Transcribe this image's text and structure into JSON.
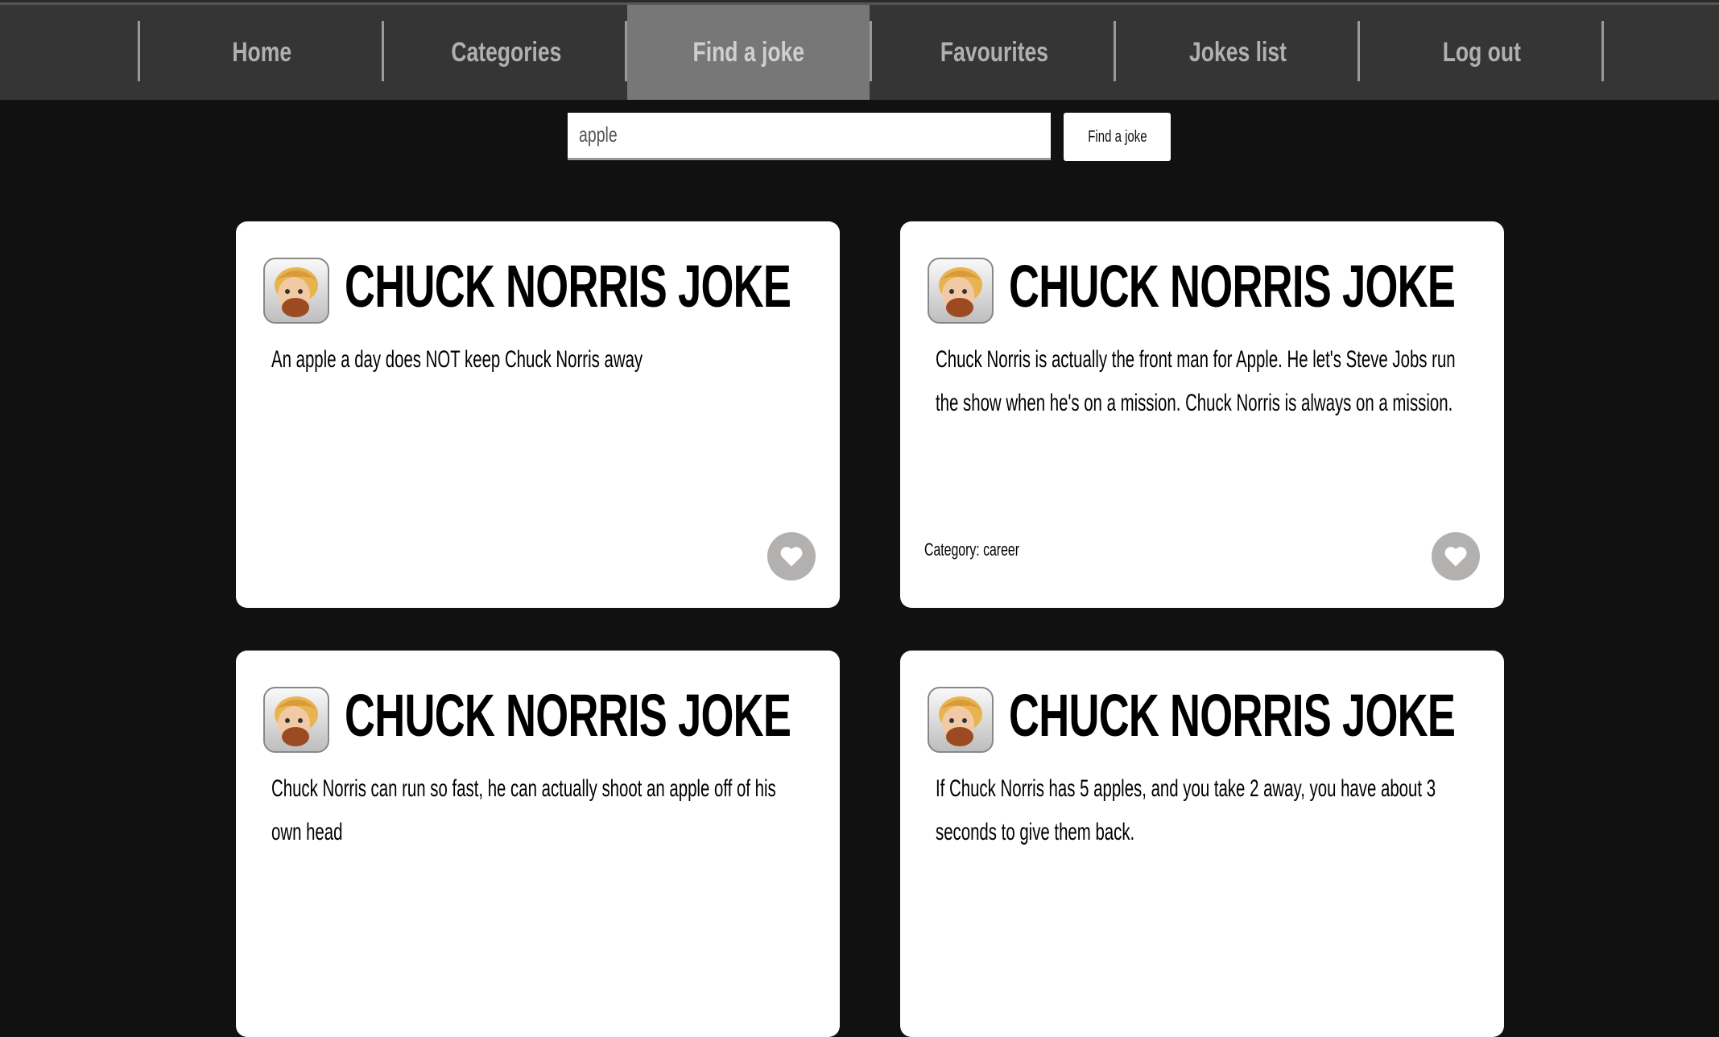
{
  "nav": {
    "items": [
      {
        "label": "Home",
        "active": false
      },
      {
        "label": "Categories",
        "active": false
      },
      {
        "label": "Find a joke",
        "active": true
      },
      {
        "label": "Favourites",
        "active": false
      },
      {
        "label": "Jokes list",
        "active": false
      },
      {
        "label": "Log out",
        "active": false
      }
    ]
  },
  "search": {
    "value": "apple",
    "button_label": "Find a joke"
  },
  "cards": [
    {
      "title": "CHUCK NORRIS JOKE",
      "text": "An apple a day does NOT keep Chuck Norris away",
      "category": null
    },
    {
      "title": "CHUCK NORRIS JOKE",
      "text": "Chuck Norris is actually the front man for Apple. He let's Steve Jobs run the show when he's on a mission. Chuck Norris is always on a mission.",
      "category": "Category: career"
    },
    {
      "title": "CHUCK NORRIS JOKE",
      "text": "Chuck Norris can run so fast, he can actually shoot an apple off of his own head",
      "category": null
    },
    {
      "title": "CHUCK NORRIS JOKE",
      "text": "If Chuck Norris has 5 apples, and you take 2 away, you have about 3 seconds to give them back.",
      "category": null
    }
  ],
  "colors": {
    "nav_bg": "#353535",
    "nav_active": "#777777",
    "page_bg": "#111111",
    "heart_btn": "#b3b0b0"
  }
}
